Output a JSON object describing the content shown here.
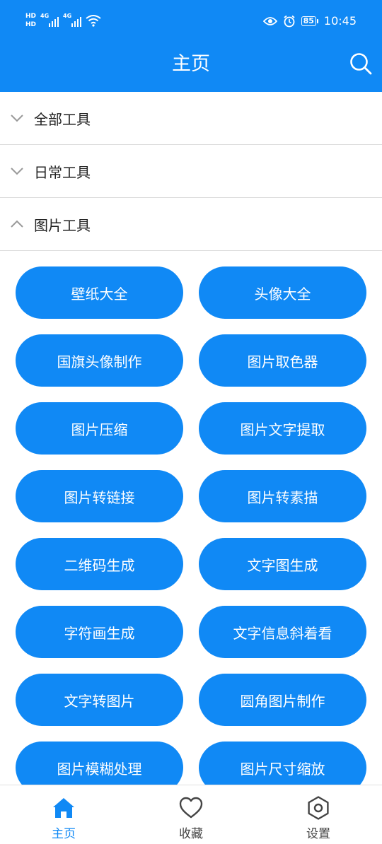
{
  "status_bar": {
    "hd1": "HD",
    "hd2": "HD",
    "net1": "4G",
    "net2": "4G",
    "battery": "85",
    "time": "10:45"
  },
  "header": {
    "title": "主页"
  },
  "categories": [
    {
      "label": "全部工具",
      "expanded": false
    },
    {
      "label": "日常工具",
      "expanded": false
    },
    {
      "label": "图片工具",
      "expanded": true
    }
  ],
  "tools": [
    "壁纸大全",
    "头像大全",
    "国旗头像制作",
    "图片取色器",
    "图片压缩",
    "图片文字提取",
    "图片转链接",
    "图片转素描",
    "二维码生成",
    "文字图生成",
    "字符画生成",
    "文字信息斜着看",
    "文字转图片",
    "圆角图片制作",
    "图片模糊处理",
    "图片尺寸缩放"
  ],
  "bottom_nav": {
    "home": "主页",
    "favorites": "收藏",
    "settings": "设置"
  },
  "colors": {
    "primary": "#1089f5",
    "inactive": "#444444"
  }
}
